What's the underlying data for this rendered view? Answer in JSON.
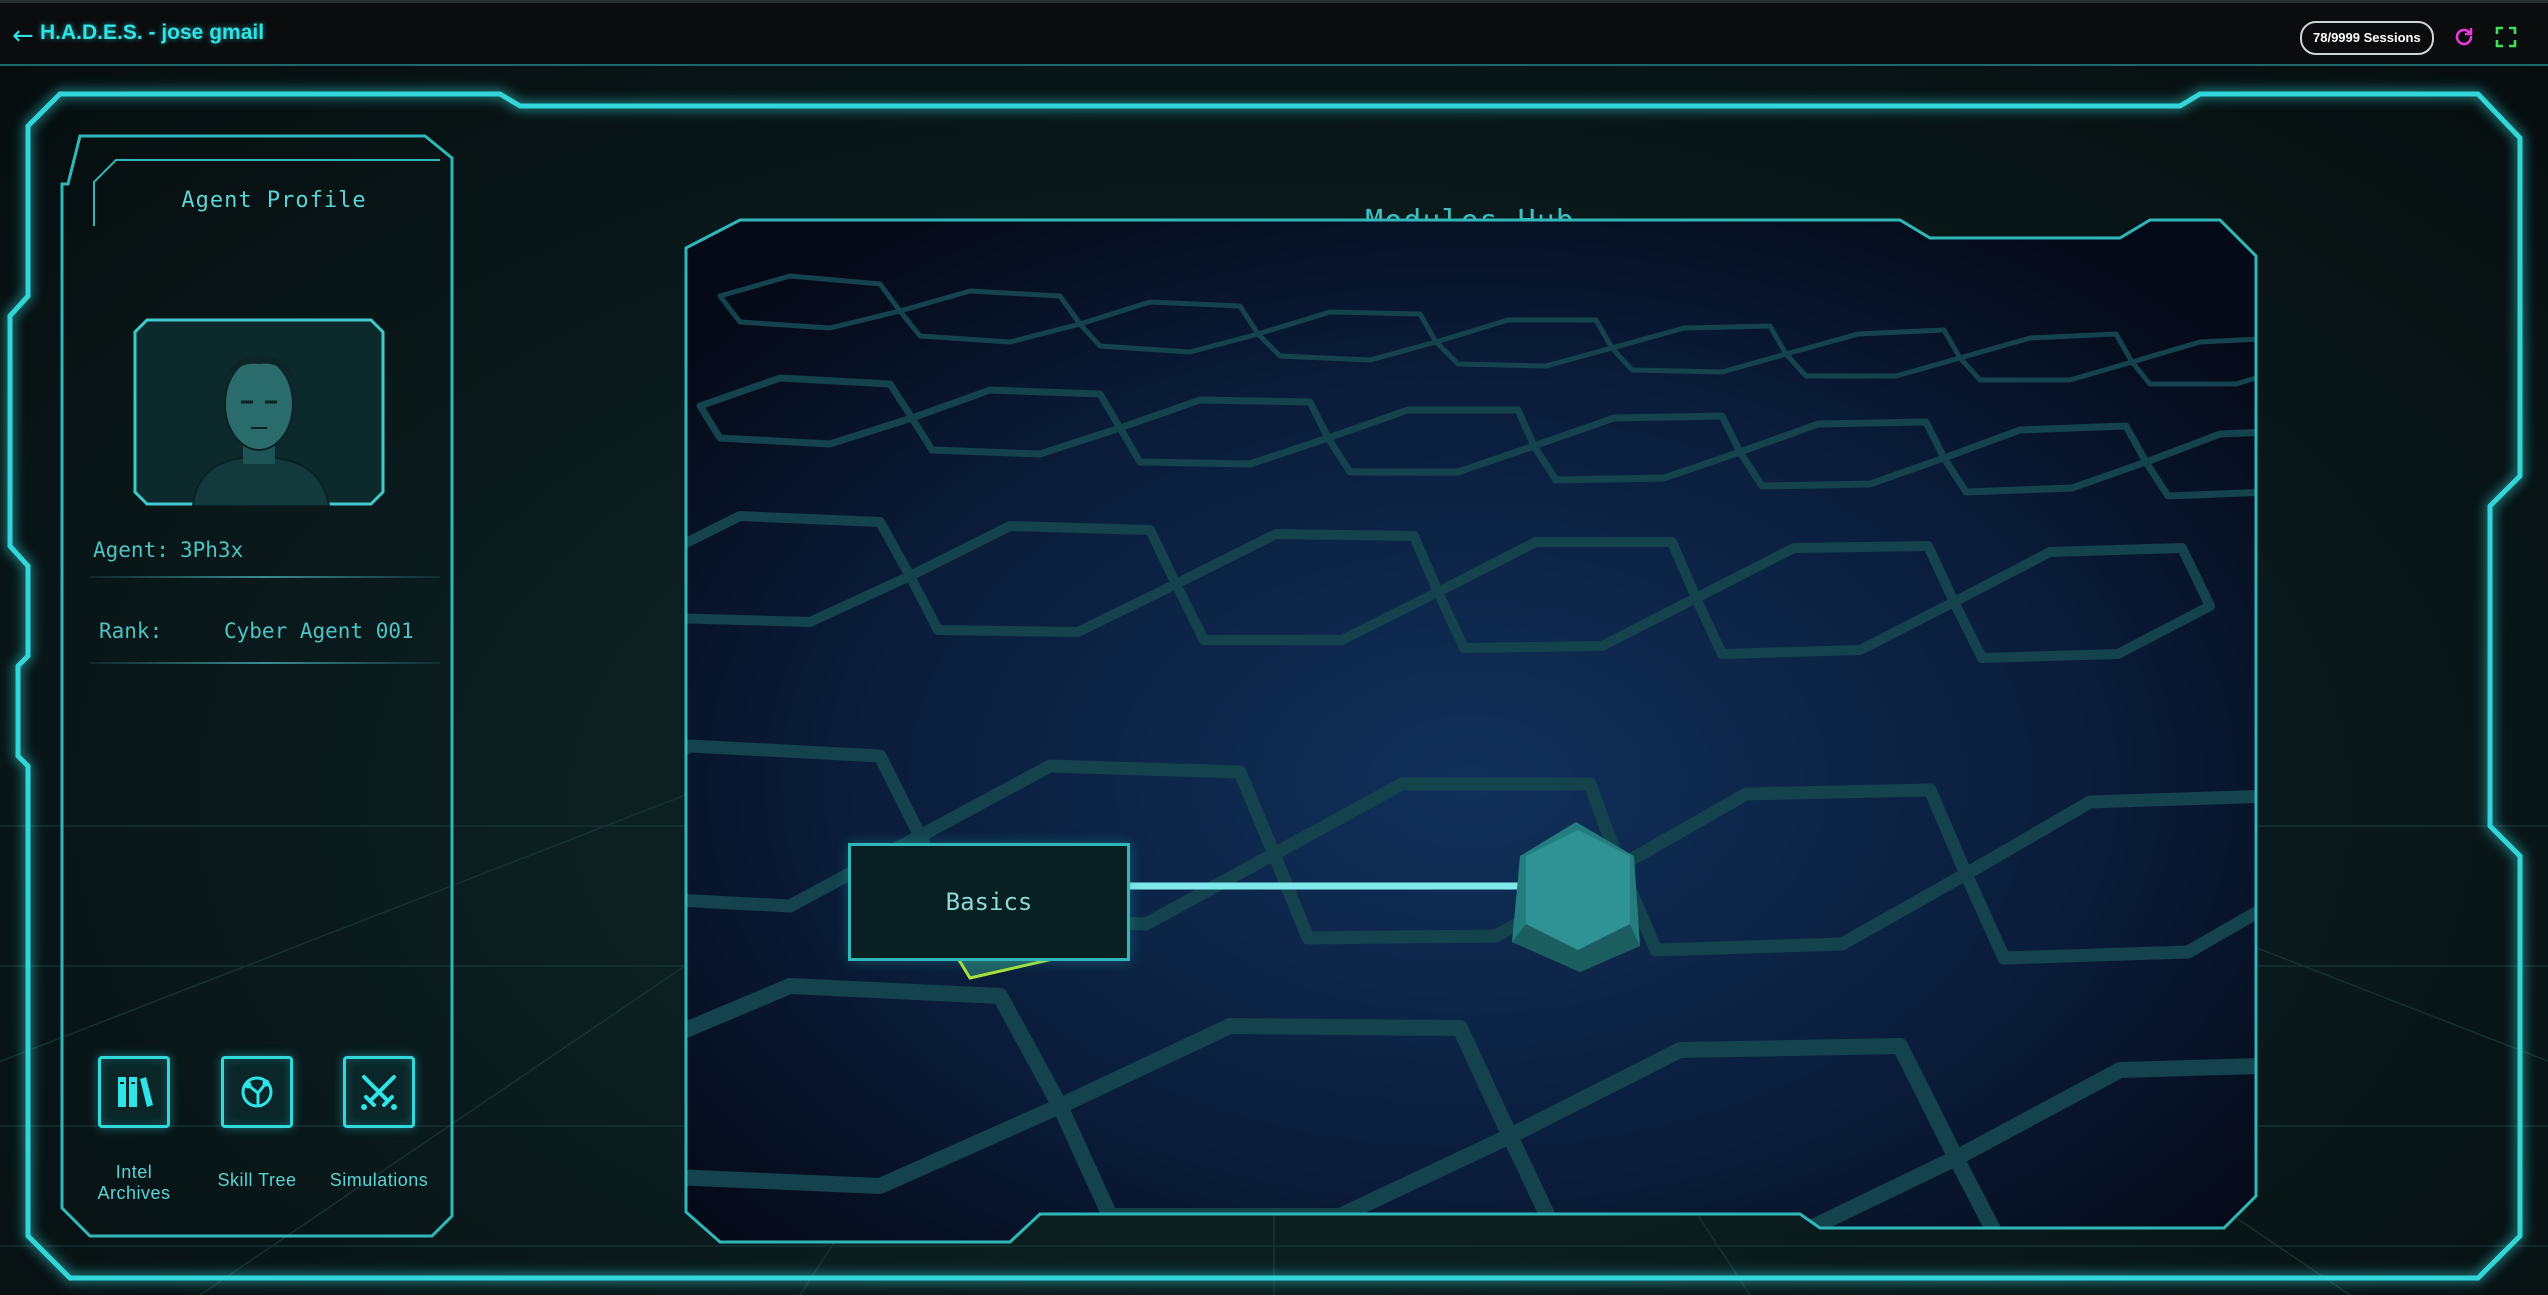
{
  "app": {
    "title": "H.A.D.E.S. - jose gmail",
    "sessions": "78/9999 Sessions",
    "icons": {
      "back": "arrow-left-icon",
      "refresh": "refresh-icon",
      "fullscreen": "fullscreen-icon"
    }
  },
  "profile": {
    "title": "Agent Profile",
    "agent_label": "Agent:",
    "agent_value": "3Ph3x",
    "rank_label": "Rank:",
    "rank_value": "Cyber Agent 001"
  },
  "nav": [
    {
      "label_line1": "Intel",
      "label_line2": "Archives",
      "icon": "books-icon"
    },
    {
      "label": "Skill Tree",
      "icon": "skill-tree-icon"
    },
    {
      "label": "Simulations",
      "icon": "crossed-swords-icon"
    }
  ],
  "hub": {
    "title": "Modules Hub",
    "modules": [
      {
        "label": "Basics",
        "state": "selected"
      },
      {
        "label": "",
        "state": "locked"
      }
    ]
  },
  "colors": {
    "accent": "#2fe3e6",
    "panel_text": "#4fc2c4",
    "selected_outline": "#a6e23a",
    "refresh": "#e43ad8",
    "fullscreen": "#3ee05a"
  }
}
